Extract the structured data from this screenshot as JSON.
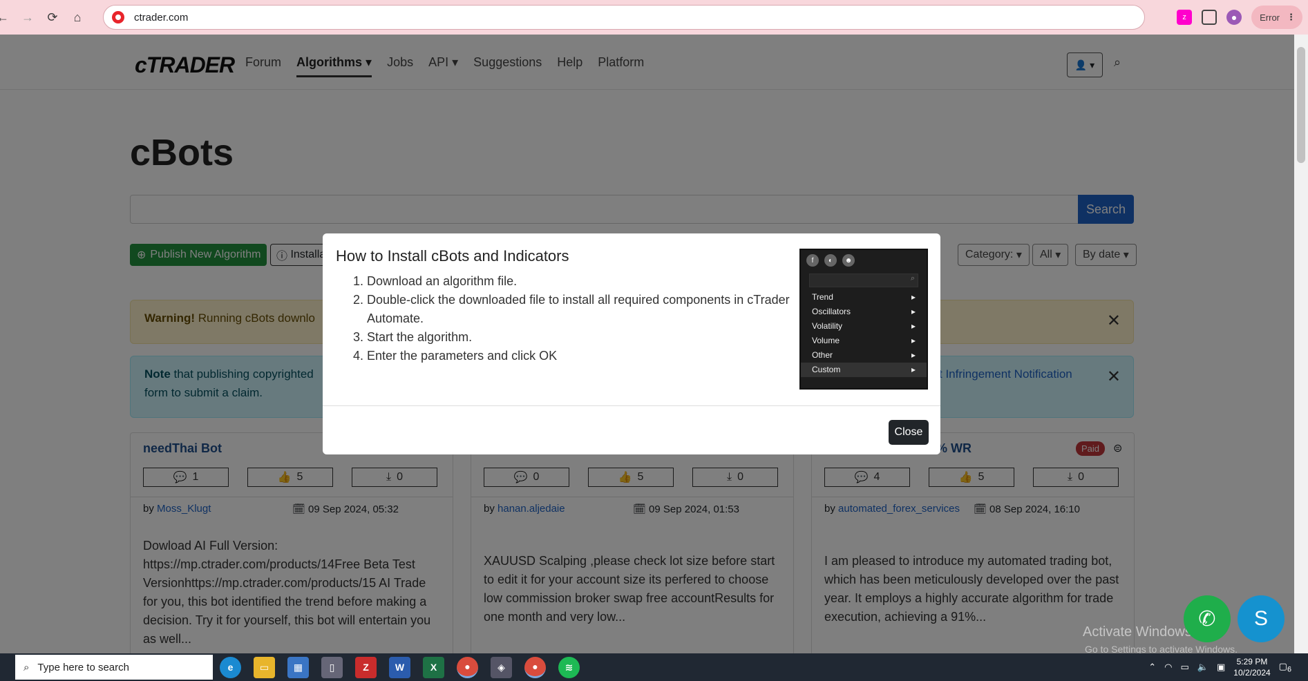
{
  "browser": {
    "url": "ctrader.com",
    "error_label": "Error"
  },
  "nav": {
    "logo_c": "c",
    "logo_rest": "TRADER",
    "links": [
      "Forum",
      "Algorithms",
      "Jobs",
      "API",
      "Suggestions",
      "Help",
      "Platform"
    ],
    "active": "Algorithms"
  },
  "page": {
    "title": "cBots",
    "search_button": "Search",
    "publish_button": "Publish New Algorithm",
    "install_button": "Installa",
    "filters": {
      "category": "Category:",
      "all": "All",
      "sort": "By date"
    }
  },
  "alerts": {
    "warning_bold": "Warning!",
    "warning_text": " Running cBots downlo",
    "note_bold": "Note",
    "note_text": " that publishing copyrighted",
    "note_text2": "form to submit a claim.",
    "note_link": "t Infringement Notification"
  },
  "cards": [
    {
      "title": "needThai Bot",
      "comments": "1",
      "likes": "5",
      "downloads": "0",
      "author_prefix": "by ",
      "author": "Moss_Klugt",
      "date": "09 Sep 2024, 05:32",
      "description": "Dowload AI Full Version: https://mp.ctrader.com/products/14Free Beta Test Versionhttps://mp.ctrader.com/products/15 AI Trade for you, this bot identified the trend before making a decision. Try it for yourself, this bot will entertain you as well..."
    },
    {
      "title": "",
      "comments": "0",
      "likes": "5",
      "downloads": "0",
      "author_prefix": "by ",
      "author": "hanan.aljedaie",
      "date": "09 Sep 2024, 01:53",
      "description": "XAUUSD Scalping ,please check lot size before start to edit it for your account size its perfered to choose low commission broker swap free accountResults for one month and very low..."
    },
    {
      "title": "% WR",
      "badge": "Paid",
      "comments": "4",
      "likes": "5",
      "downloads": "0",
      "author_prefix": "by ",
      "author": "automated_forex_services",
      "date": "08 Sep 2024, 16:10",
      "description": "I am pleased to introduce my automated trading bot, which has been meticulously developed over the past year. It employs a highly accurate algorithm for trade execution, achieving a 91%..."
    }
  ],
  "modal": {
    "title": "How to Install cBots and Indicators",
    "steps": [
      "Download an algorithm file.",
      "Double-click the downloaded file to install all required components in cTrader Automate.",
      "Start the algorithm.",
      "Enter the parameters and click OK"
    ],
    "menu_items": [
      "Trend",
      "Oscillators",
      "Volatility",
      "Volume",
      "Other",
      "Custom"
    ],
    "close_button": "Close"
  },
  "watermark": {
    "line1": "Activate Windows",
    "line2": "Go to Settings to activate Windows."
  },
  "taskbar": {
    "search_placeholder": "Type here to search",
    "time": "5:29 PM",
    "date": "10/2/2024",
    "notification_count": "6"
  }
}
